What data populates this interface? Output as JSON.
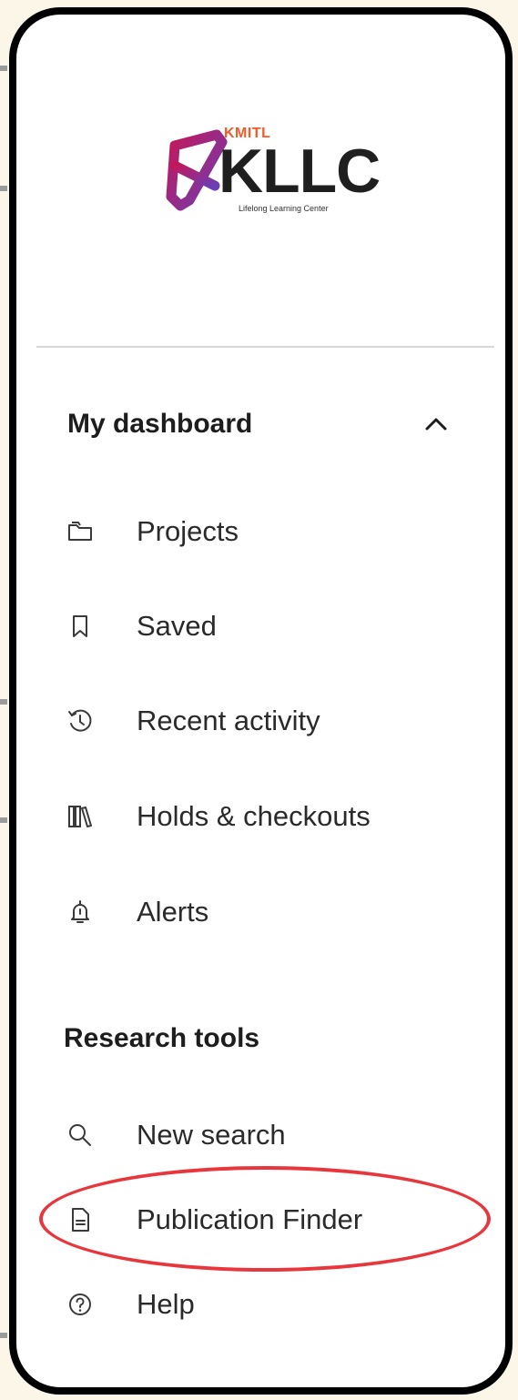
{
  "logo": {
    "kmitl": "KMITL",
    "kllc": "KLLC",
    "tagline": "Lifelong Learning Center",
    "colors": {
      "orange": "#f15a29",
      "magenta": "#c2185b",
      "purple": "#6a3fb5"
    }
  },
  "dashboard": {
    "title": "My dashboard",
    "toggle_icon": "chevron-up-icon",
    "items": [
      {
        "label": "Projects",
        "icon": "folder-icon"
      },
      {
        "label": "Saved",
        "icon": "bookmark-icon"
      },
      {
        "label": "Recent activity",
        "icon": "history-icon"
      },
      {
        "label": "Holds & checkouts",
        "icon": "books-icon"
      },
      {
        "label": "Alerts",
        "icon": "bell-icon"
      }
    ]
  },
  "research_tools": {
    "title": "Research tools",
    "items": [
      {
        "label": "New search",
        "icon": "search-icon"
      },
      {
        "label": "Publication Finder",
        "icon": "document-icon"
      },
      {
        "label": "Help",
        "icon": "help-icon"
      }
    ]
  },
  "highlight": {
    "target": "Publication Finder",
    "color": "#e8363c"
  }
}
